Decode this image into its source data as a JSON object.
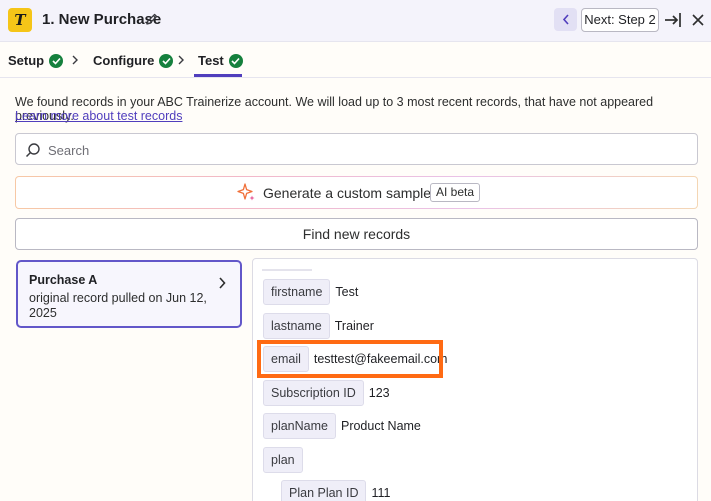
{
  "header": {
    "logo_letter": "T",
    "title": "1. New Purchase",
    "next_label": "Next: Step 2"
  },
  "steps": [
    {
      "label": "Setup",
      "status": "complete"
    },
    {
      "label": "Configure",
      "status": "complete"
    },
    {
      "label": "Test",
      "status": "complete",
      "active": true
    }
  ],
  "content": {
    "info_text": "We found records in your ABC Trainerize account. We will load up to 3 most recent records, that have not appeared previously.",
    "learn_link": "Learn more about test records",
    "search_placeholder": "Search",
    "generate_label": "Generate a custom sample",
    "ai_badge": "AI beta",
    "find_label": "Find new records"
  },
  "record": {
    "title": "Purchase A",
    "subtitle": "original record pulled on Jun 12, 2025"
  },
  "fields": [
    {
      "key": "firstname",
      "value": "Test"
    },
    {
      "key": "lastname",
      "value": "Trainer"
    },
    {
      "key": "email",
      "value": "testtest@fakeemail.com"
    },
    {
      "key": "Subscription ID",
      "value": "123"
    },
    {
      "key": "planName",
      "value": "Product Name"
    },
    {
      "key": "plan",
      "value": ""
    },
    {
      "key": "Plan Plan ID",
      "value": "111"
    }
  ],
  "colors": {
    "accent": "#503ebd",
    "success": "#15803d",
    "highlight": "#ff6a13",
    "logo": "#f5c518"
  }
}
